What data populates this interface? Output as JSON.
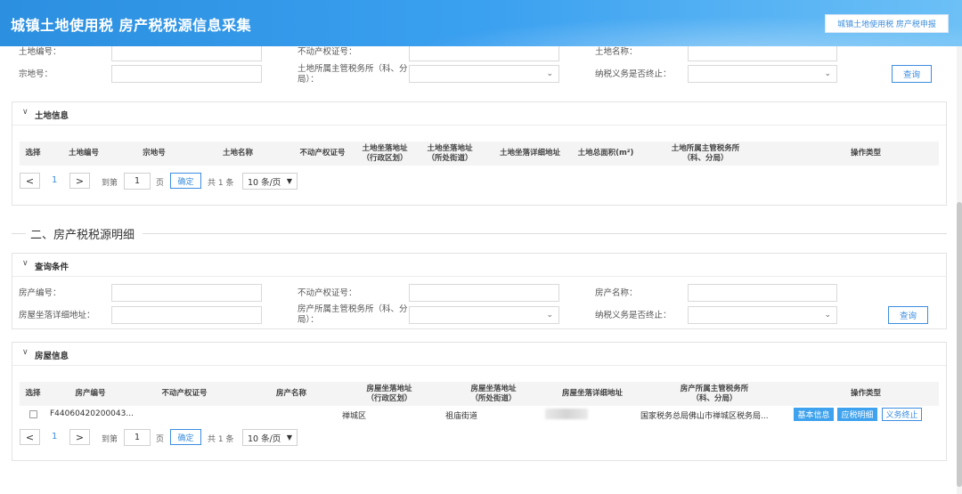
{
  "header": {
    "title": "城镇土地使用税 房产税税源信息采集",
    "button_label": "城镇土地使用税 房产税申报"
  },
  "land_query": {
    "land_no_label": "土地编号：",
    "parcel_no_label": "宗地号：",
    "property_cert_label": "不动产权证号：",
    "tax_office_label": "土地所属主管税务所（科、分局）：",
    "land_name_label": "土地名称：",
    "terminated_label": "纳税义务是否终止：",
    "query_button": "查询"
  },
  "land_info": {
    "title": "土地信息",
    "columns": [
      "选择",
      "土地编号",
      "宗地号",
      "土地名称",
      "不动产权证号",
      "土地坐落地址\n（行政区划）",
      "土地坐落地址\n（所处街道）",
      "土地坐落详细地址",
      "土地总面积(m²)",
      "土地所属主管税务所\n（科、分局）",
      "操作类型"
    ],
    "pager": {
      "prev": "<",
      "page": "1",
      "next": ">",
      "goto_label": "到第",
      "goto_value": "1",
      "page_unit": "页",
      "confirm": "确定",
      "total": "共 1 条",
      "page_size": "10 条/页"
    }
  },
  "house_section": {
    "title": "二、房产税税源明细"
  },
  "house_query": {
    "title": "查询条件",
    "house_no_label": "房产编号：",
    "address_label": "房屋坐落详细地址：",
    "property_cert_label": "不动产权证号：",
    "tax_office_label": "房产所属主管税务所（科、分局）：",
    "house_name_label": "房产名称：",
    "terminated_label": "纳税义务是否终止：",
    "query_button": "查询"
  },
  "house_info": {
    "title": "房屋信息",
    "columns": [
      "选择",
      "房产编号",
      "不动产权证号",
      "房产名称",
      "房屋坐落地址\n（行政区划）",
      "房屋坐落地址\n（所处街道）",
      "房屋坐落详细地址",
      "房产所属主管税务所\n（科、分局）",
      "操作类型"
    ],
    "rows": [
      {
        "house_no": "F44060420200043...",
        "property_cert": "",
        "house_name": "",
        "district": "禅城区",
        "street": "祖庙街道",
        "tax_office": "国家税务总局佛山市禅城区税务局...",
        "actions": [
          "基本信息",
          "应税明细",
          "义务终止"
        ]
      }
    ],
    "pager": {
      "prev": "<",
      "page": "1",
      "next": ">",
      "goto_label": "到第",
      "goto_value": "1",
      "page_unit": "页",
      "confirm": "确定",
      "total": "共 1 条",
      "page_size": "10 条/页"
    }
  }
}
